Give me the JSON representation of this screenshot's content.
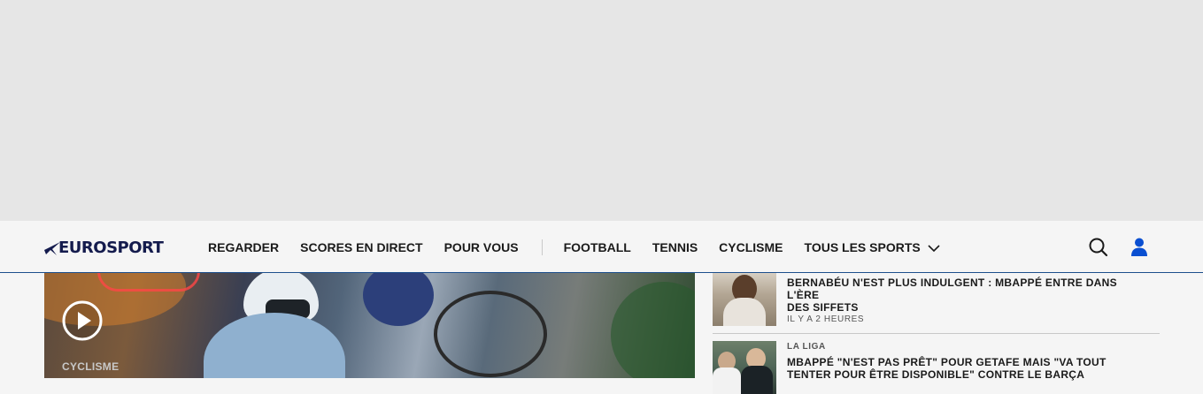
{
  "brand": {
    "logo_text": "EUROSPORT",
    "color": "#141b4d"
  },
  "nav": {
    "primary": [
      "REGARDER",
      "SCORES EN DIRECT",
      "POUR VOUS"
    ],
    "sports": [
      "FOOTBALL",
      "TENNIS",
      "CYCLISME"
    ],
    "all_sports": "TOUS LES SPORTS"
  },
  "header_icons": {
    "search": "search-icon",
    "user": "user-icon",
    "user_color": "#0a4fd1"
  },
  "hero": {
    "tag": "CYCLISME",
    "icon": "play-icon"
  },
  "sidebar": {
    "articles": [
      {
        "category": "",
        "title_lines": [
          "BERNABÉU N'EST PLUS INDULGENT : MBAPPÉ ENTRE DANS L'ÈRE",
          "DES SIFFETS"
        ],
        "time": "IL Y A 2 HEURES"
      },
      {
        "category": "LA LIGA",
        "title_lines": [
          "MBAPPÉ \"N'EST PAS PRÊT\" POUR GETAFE MAIS \"VA TOUT",
          "TENTER POUR ÊTRE DISPONIBLE\" CONTRE LE BARÇA"
        ],
        "time": ""
      }
    ]
  }
}
